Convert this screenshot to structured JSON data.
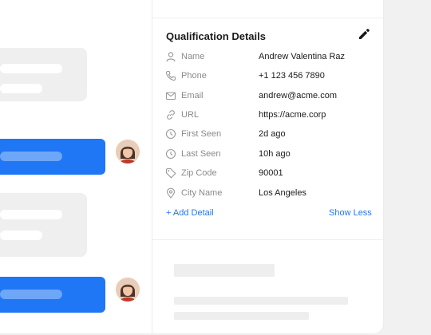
{
  "panel": {
    "title": "Qualification Details",
    "edit_icon": "pencil-icon",
    "rows": [
      {
        "icon": "user-icon",
        "label": "Name",
        "value": "Andrew Valentina Raz"
      },
      {
        "icon": "phone-icon",
        "label": "Phone",
        "value": "+1 123 456 7890"
      },
      {
        "icon": "mail-icon",
        "label": "Email",
        "value": "andrew@acme.com"
      },
      {
        "icon": "link-icon",
        "label": "URL",
        "value": "https://acme.corp"
      },
      {
        "icon": "clock-icon",
        "label": "First Seen",
        "value": "2d ago"
      },
      {
        "icon": "clock-icon",
        "label": "Last Seen",
        "value": "10h ago"
      },
      {
        "icon": "tag-icon",
        "label": "Zip Code",
        "value": "90001"
      },
      {
        "icon": "location-icon",
        "label": "City Name",
        "value": "Los Angeles"
      }
    ],
    "add_detail": "+ Add Detail",
    "show_less": "Show Less"
  },
  "colors": {
    "accent": "#1f77f5",
    "muted": "#8a8a8a",
    "placeholder": "#efefef"
  }
}
